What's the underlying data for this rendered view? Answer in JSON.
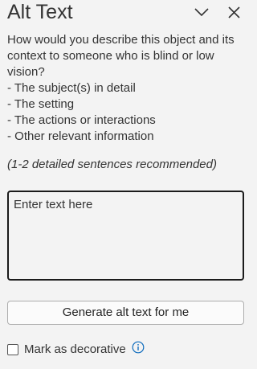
{
  "header": {
    "title": "Alt Text",
    "collapse_icon": "chevron-down-icon",
    "close_icon": "close-icon"
  },
  "description": {
    "intro": "How would you describe this object and its context to someone who is blind or low vision?",
    "items": [
      "- The subject(s) in detail",
      "- The setting",
      "- The actions or interactions",
      "- Other relevant information"
    ],
    "recommendation": "(1-2 detailed sentences recommended)"
  },
  "alt_text_input": {
    "value": "",
    "placeholder": "Enter text here"
  },
  "generate_button": {
    "label": "Generate alt text for me"
  },
  "decorative": {
    "label": "Mark as decorative",
    "checked": false,
    "info_icon": "info-icon"
  },
  "colors": {
    "background": "#f3f3f3",
    "text": "#333333",
    "info_accent": "#0f6cbd"
  }
}
